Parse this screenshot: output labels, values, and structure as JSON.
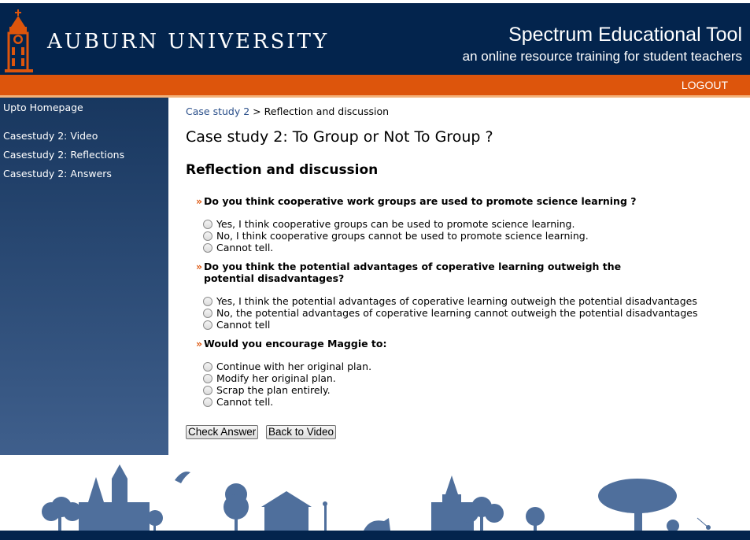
{
  "header": {
    "logo_text": "AUBURN UNIVERSITY",
    "site_title": "Spectrum Educational Tool",
    "site_subtitle": "an online resource training for student teachers",
    "logout_label": "LOGOUT"
  },
  "sidebar": {
    "items": [
      {
        "label": "Upto Homepage"
      },
      {
        "label": "Casestudy 2: Video"
      },
      {
        "label": "Casestudy 2: Reflections"
      },
      {
        "label": "Casestudy 2: Answers"
      }
    ]
  },
  "breadcrumb": {
    "link": "Case study 2",
    "separator": ">",
    "current": "Reflection and discussion"
  },
  "page_title": "Case study 2: To Group or Not To Group ?",
  "section_title": "Reflection and discussion",
  "questions": [
    {
      "bullet": "»",
      "text": "Do you think cooperative work groups are used to promote science learning ?",
      "options": [
        "Yes, I think cooperative groups can be used to promote science learning.",
        "No, I think cooperative groups cannot be used to promote science learning.",
        "Cannot tell."
      ]
    },
    {
      "bullet": "»",
      "text": "Do you think the potential advantages of coperative learning outweigh the potential disadvantages?",
      "options": [
        "Yes, I think the potential advantages of coperative learning outweigh the potential disadvantages",
        "No, the potential advantages of coperative learning cannot outweigh the potential disadvantages",
        "Cannot tell"
      ]
    },
    {
      "bullet": "»",
      "text": "Would you encourage Maggie to:",
      "options": [
        "Continue with her original plan.",
        "Modify her original plan.",
        "Scrap the plan entirely.",
        "Cannot tell."
      ]
    }
  ],
  "buttons": {
    "check_answer": "Check Answer",
    "back_to_video": "Back to Video"
  },
  "colors": {
    "navy": "#03244d",
    "orange": "#dd550c",
    "skyline": "#4f6f9c"
  }
}
